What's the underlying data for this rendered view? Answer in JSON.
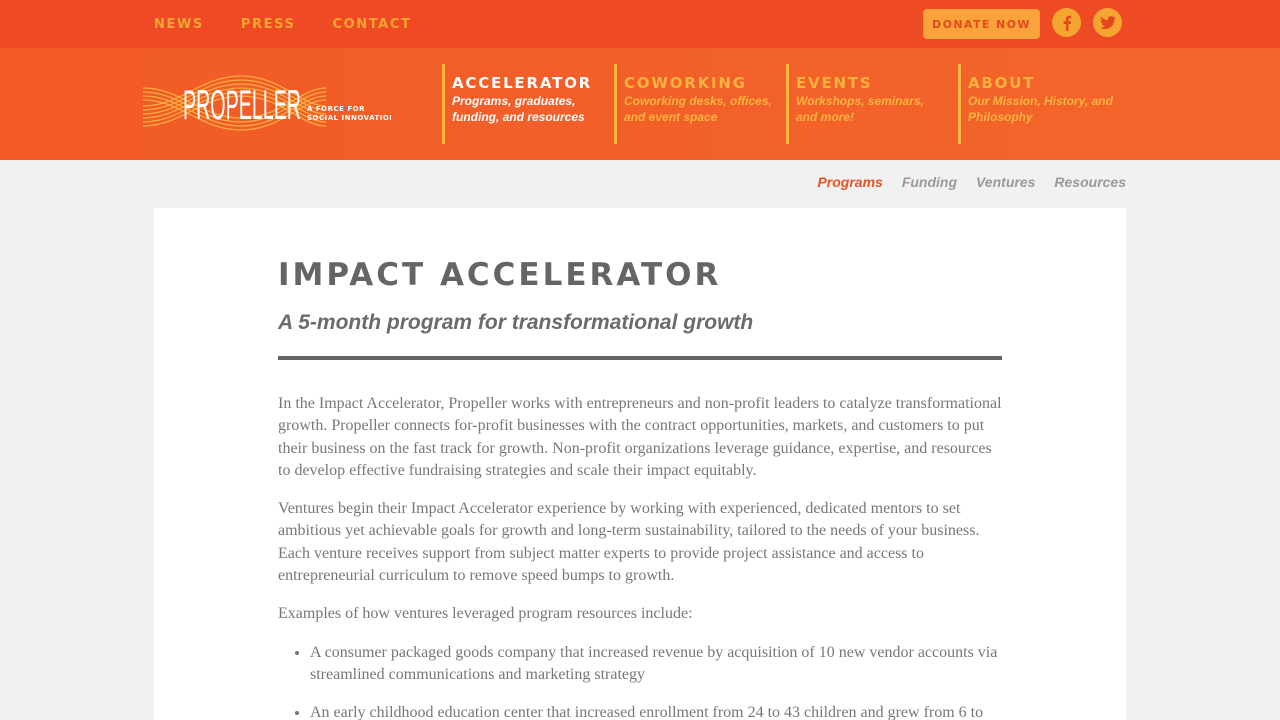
{
  "topbar": {
    "links": [
      "NEWS",
      "PRESS",
      "CONTACT"
    ],
    "donate_label": "DONATE NOW",
    "social": [
      "facebook-icon",
      "twitter-icon"
    ]
  },
  "logo": {
    "wordmark": "PROPELLER",
    "tagline_1": "A FORCE FOR",
    "tagline_2": "SOCIAL INNOVATION"
  },
  "nav": [
    {
      "title": "ACCELERATOR",
      "desc": "Programs, graduates, funding, and resources"
    },
    {
      "title": "COWORKING",
      "desc": "Coworking desks, offices, and event space"
    },
    {
      "title": "EVENTS",
      "desc": "Workshops, seminars, and more!"
    },
    {
      "title": "ABOUT",
      "desc": "Our Mission, History, and Philosophy"
    }
  ],
  "subnav": [
    "Programs",
    "Funding",
    "Ventures",
    "Resources"
  ],
  "main": {
    "title": "IMPACT ACCELERATOR",
    "subtitle": "A 5-month program for transformational growth",
    "paragraphs": [
      "In the Impact Accelerator, Propeller works with entrepreneurs and non-profit leaders to catalyze transformational growth. Propeller connects for-profit businesses with the contract opportunities, markets, and customers to put their business on the fast track for growth. Non-profit organizations leverage guidance, expertise, and resources to develop effective fundraising strategies and scale their impact equitably.",
      "Ventures begin their Impact Accelerator experience by working with experienced, dedicated mentors to set ambitious yet achievable goals for growth and long-term sustainability, tailored to the needs of your business. Each venture receives support from subject matter experts to provide project assistance and access to entrepreneurial curriculum to remove speed bumps to growth.",
      "Examples of how ventures leveraged program resources include:"
    ],
    "examples": [
      "A consumer packaged goods company that increased revenue by acquisition of 10 new vendor accounts via streamlined communications and marketing strategy",
      "An early childhood education center that increased enrollment from 24 to 43 children and grew from 6 to"
    ]
  }
}
